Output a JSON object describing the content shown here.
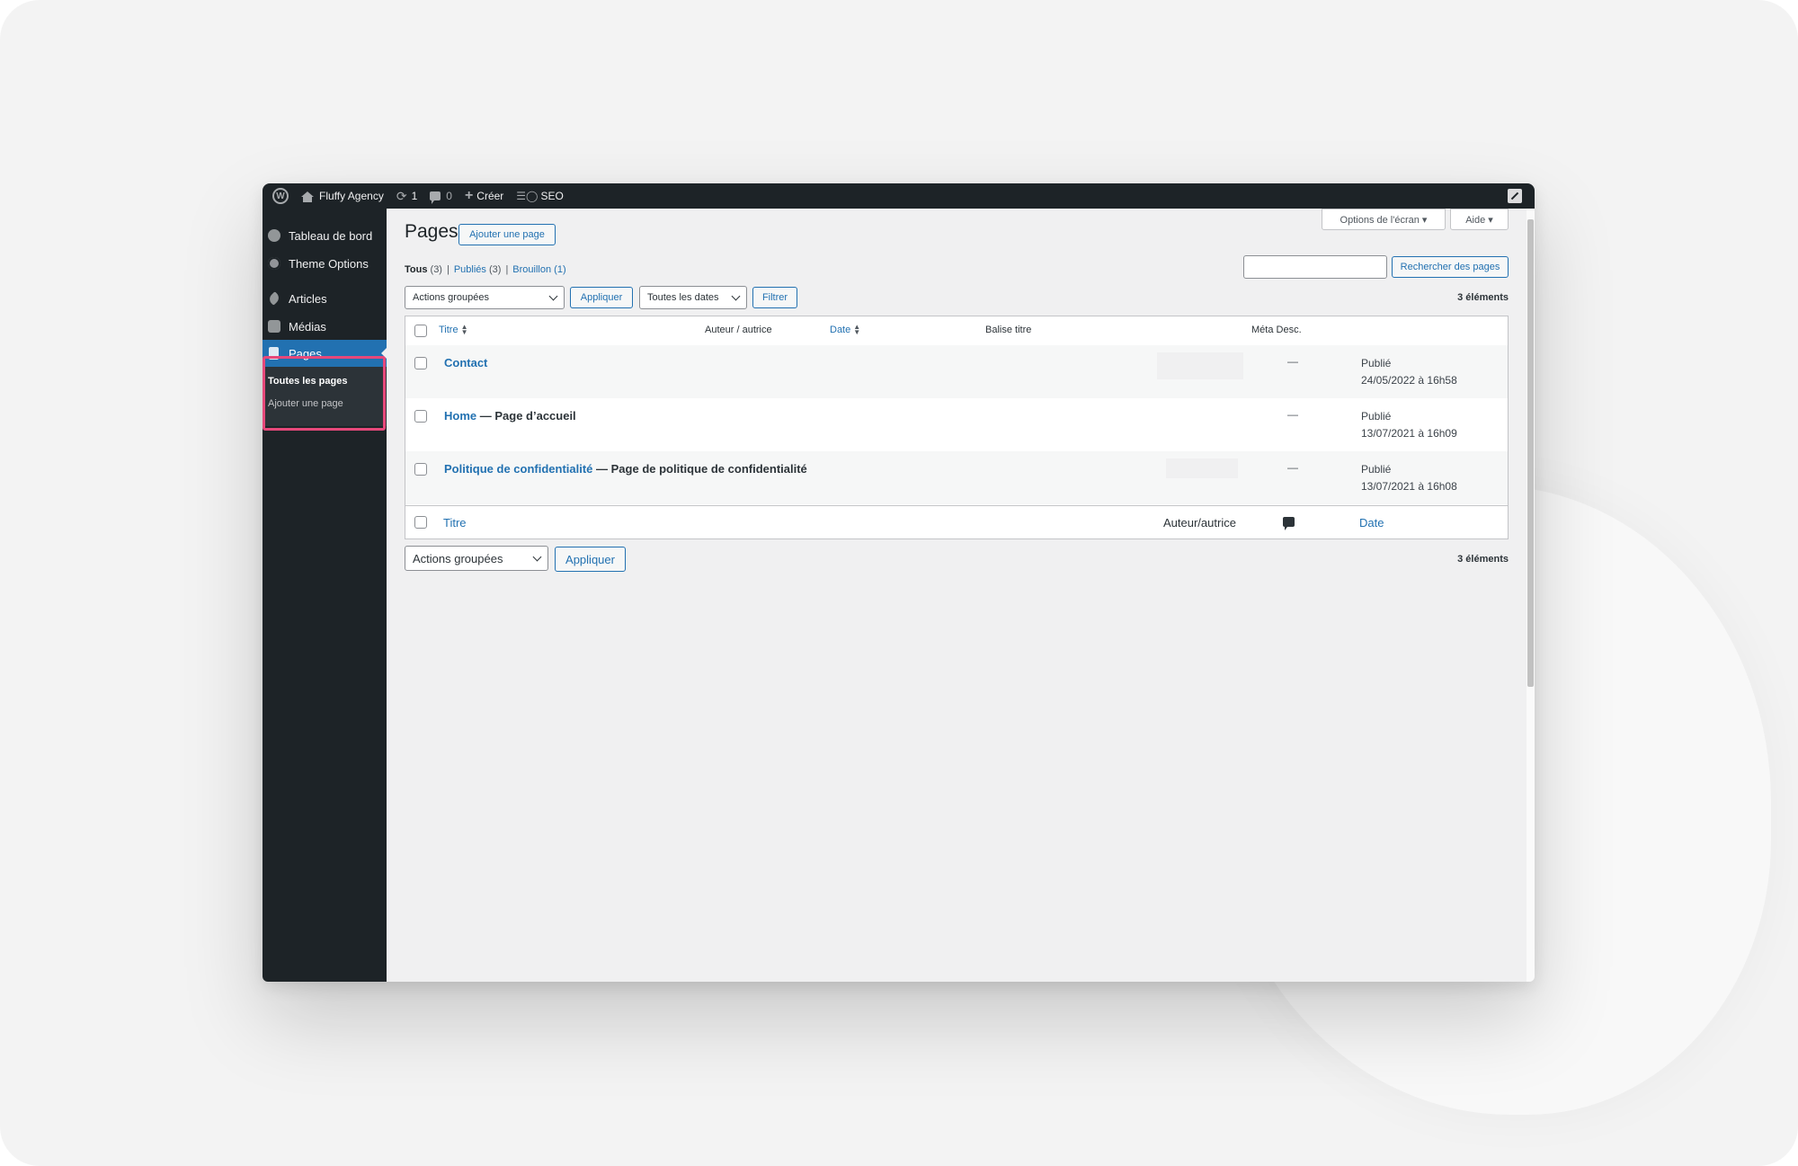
{
  "adminbar": {
    "site_name": "Fluffy Agency",
    "updates_count": "1",
    "comments_count": "0",
    "create_label": "Créer",
    "seo_label": "SEO"
  },
  "sidebar": {
    "items": [
      {
        "label": "Tableau de bord",
        "icon": "dashboard-icon"
      },
      {
        "label": "Theme Options",
        "icon": "gear-icon"
      },
      {
        "label": "Articles",
        "icon": "pin-icon"
      },
      {
        "label": "Médias",
        "icon": "media-icon"
      },
      {
        "label": "Pages",
        "icon": "pages-icon"
      }
    ],
    "submenu": [
      "Toutes les pages",
      "Ajouter une page"
    ],
    "highlight_color": "#e6487a"
  },
  "header": {
    "title": "Pages",
    "add_button": "Ajouter une page",
    "screen_options": "Options de l'écran ▾",
    "help": "Aide ▾"
  },
  "filters": {
    "all": "Tous",
    "all_count": "(3)",
    "published": "Publiés",
    "published_count": "(3)",
    "draft": "Brouillon",
    "draft_count": "(1)",
    "separator": "|"
  },
  "search": {
    "value": "",
    "button": "Rechercher des pages"
  },
  "toolbar_top": {
    "bulk_select": "Actions groupées",
    "apply": "Appliquer",
    "dates_select": "Toutes les dates",
    "filter": "Filtrer",
    "items_count": "3 éléments"
  },
  "table": {
    "headers": {
      "title": "Titre",
      "author": "Auteur / autrice",
      "date": "Date",
      "seo_title": "Balise titre",
      "meta_desc": "Méta Desc."
    },
    "rows": [
      {
        "title": "Contact",
        "suffix": "",
        "meta": "—",
        "status": "Publié",
        "date": "24/05/2022 à 16h58"
      },
      {
        "title": "Home",
        "suffix": " — Page d’accueil",
        "meta": "—",
        "status": "Publié",
        "date": "13/07/2021 à 16h09"
      },
      {
        "title": "Politique de confidentialité",
        "suffix": " — Page de politique de confidentialité",
        "meta": "—",
        "status": "Publié",
        "date": "13/07/2021 à 16h08"
      }
    ],
    "footer": {
      "title": "Titre",
      "author": "Auteur/autrice",
      "date": "Date"
    }
  },
  "toolbar_bottom": {
    "bulk_select": "Actions groupées",
    "apply": "Appliquer",
    "items_count": "3 éléments"
  },
  "colors": {
    "accent": "#2271b1",
    "adminbar_bg": "#1d2327",
    "current_menu": "#2271b1"
  }
}
